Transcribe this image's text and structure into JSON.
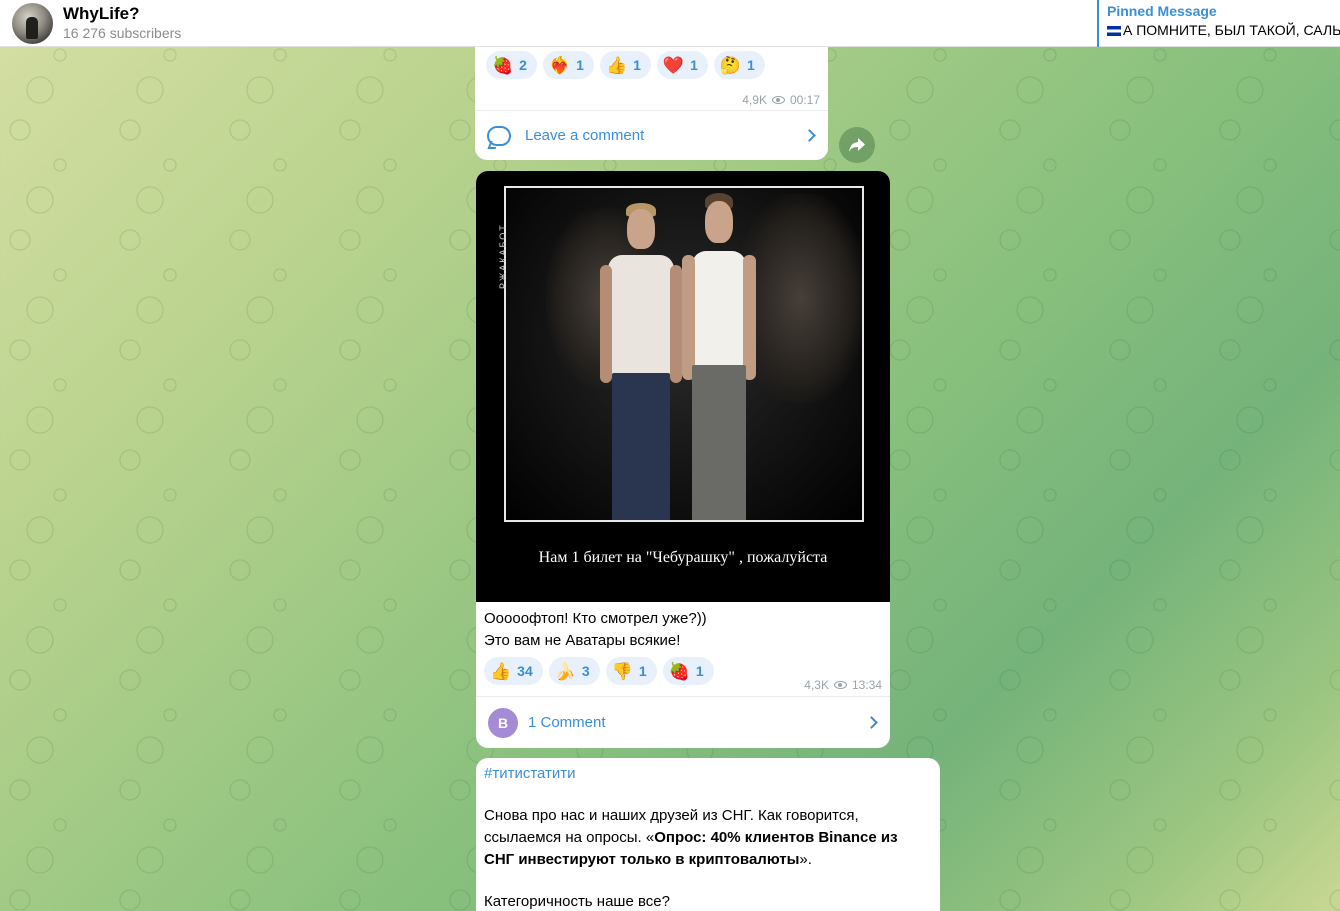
{
  "header": {
    "channel_title": "WhyLife?",
    "subscribers": "16 276 subscribers",
    "pinned_title": "Pinned Message",
    "pinned_text": "А ПОМНИТЕ, БЫЛ ТАКОЙ, САЛЬ..."
  },
  "post1": {
    "reactions": [
      {
        "emoji": "🍓",
        "count": "2"
      },
      {
        "emoji": "❤️‍🔥",
        "count": "1"
      },
      {
        "emoji": "👍",
        "count": "1"
      },
      {
        "emoji": "❤️",
        "count": "1"
      },
      {
        "emoji": "🤔",
        "count": "1"
      }
    ],
    "views": "4,9K",
    "time": "00:17",
    "comment_label": "Leave a comment"
  },
  "post2": {
    "image_side_label": "РЖАКАБОТ",
    "image_caption": "Нам 1 билет на \"Чебурашку\" , пожалуйста",
    "text_line1": "Ооооофтоп! Кто смотрел уже?))",
    "text_line2": "Это вам не Аватары всякие!",
    "reactions": [
      {
        "emoji": "👍",
        "count": "34"
      },
      {
        "emoji": "🍌",
        "count": "3"
      },
      {
        "emoji": "👎",
        "count": "1"
      },
      {
        "emoji": "🍓",
        "count": "1"
      }
    ],
    "views": "4,3K",
    "time": "13:34",
    "commenter_initial": "B",
    "comment_label": "1 Comment"
  },
  "post3": {
    "hashtag": "#титистатити",
    "p1_a": "Снова про нас и наших друзей из СНГ. Как говорится, ссылаемся на опросы. «",
    "p1_bold": "Опрос: 40% клиентов Binance из СНГ инвестируют только в криптовалюты",
    "p1_end": "».",
    "p2": "Категоричность наше все?"
  }
}
